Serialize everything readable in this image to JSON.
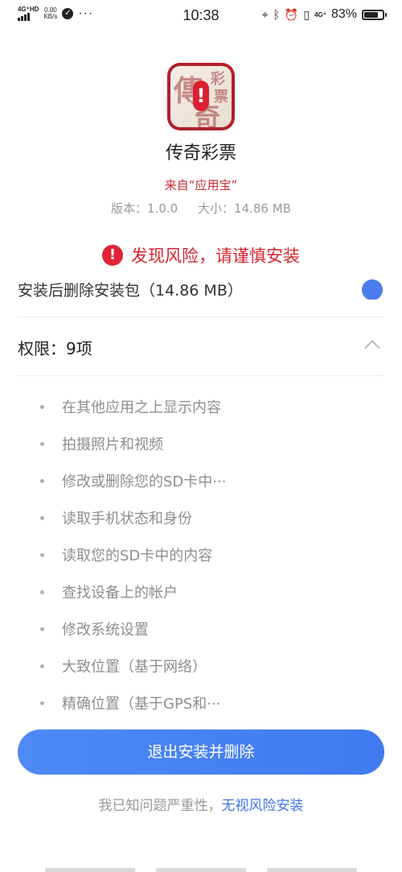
{
  "status_bar": {
    "network_type": "4G⁺HD",
    "speed_value": "0.00",
    "speed_unit": "KB/s",
    "more": "···",
    "time": "10:38",
    "network_4g": "4G⁺",
    "battery": "83%",
    "battery_level": 0.83
  },
  "app": {
    "icon_chars": [
      "傳",
      "奇",
      "彩",
      "票"
    ],
    "name": "传奇彩票",
    "source": "来自“应用宝”",
    "version": "版本：1.0.0",
    "size": "大小：14.86 MB"
  },
  "risk": {
    "icon": "!",
    "text": "发现风险，请谨慎安装"
  },
  "cut_row": {
    "text": "安装后删除安装包（14.86 MB）"
  },
  "permissions": {
    "title": "权限：9项",
    "items": [
      "在其他应用之上显示内容",
      "拍摄照片和视频",
      "修改或删除您的SD卡中···",
      "读取手机状态和身份",
      "读取您的SD卡中的内容",
      "查找设备上的帐户",
      "修改系统设置",
      "大致位置（基于网络）",
      "精确位置（基于GPS和···"
    ]
  },
  "actions": {
    "exit_button": "退出安装并删除",
    "acknowledge": "我已知问题严重性，",
    "ignore_link": "无视风险安装"
  },
  "colors": {
    "accent_blue": "#3f7af0",
    "risk_red": "#d8242f"
  }
}
